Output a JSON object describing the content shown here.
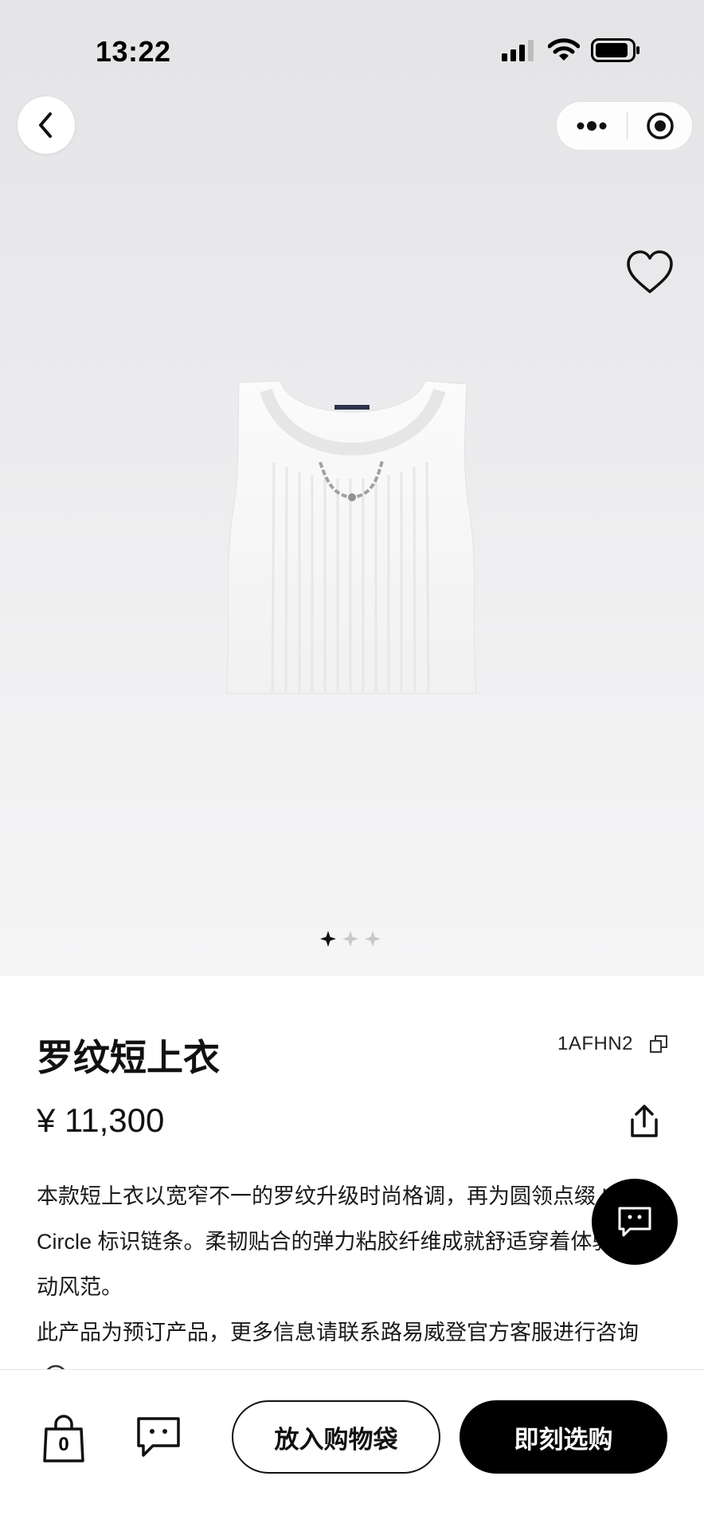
{
  "status_bar": {
    "time": "13:22"
  },
  "nav": {
    "back_icon": "chevron-left-icon",
    "more_icon": "more-dots-icon",
    "close_icon": "target-circle-icon"
  },
  "gallery": {
    "image_icon": "ribbed-crop-top-product-image",
    "image_count": 3,
    "active_index": 0
  },
  "product": {
    "title": "罗纹短上衣",
    "sku": "1AFHN2",
    "price": "¥ 11,300",
    "description": [
      "本款短上衣以宽窄不一的罗纹升级时尚格调，再为圆领点缀 L",
      "Circle 标识链条。柔韧贴合的弹力粘胶纤维成就舒适穿着体验",
      "动风范。",
      "此产品为预订产品，更多信息请联系路易威登官方客服进行咨询"
    ]
  },
  "bottom_bar": {
    "bag_count": "0",
    "add_to_bag_label": "放入购物袋",
    "buy_now_label": "即刻选购"
  },
  "colors": {
    "accent": "#000000",
    "background": "#ffffff"
  }
}
